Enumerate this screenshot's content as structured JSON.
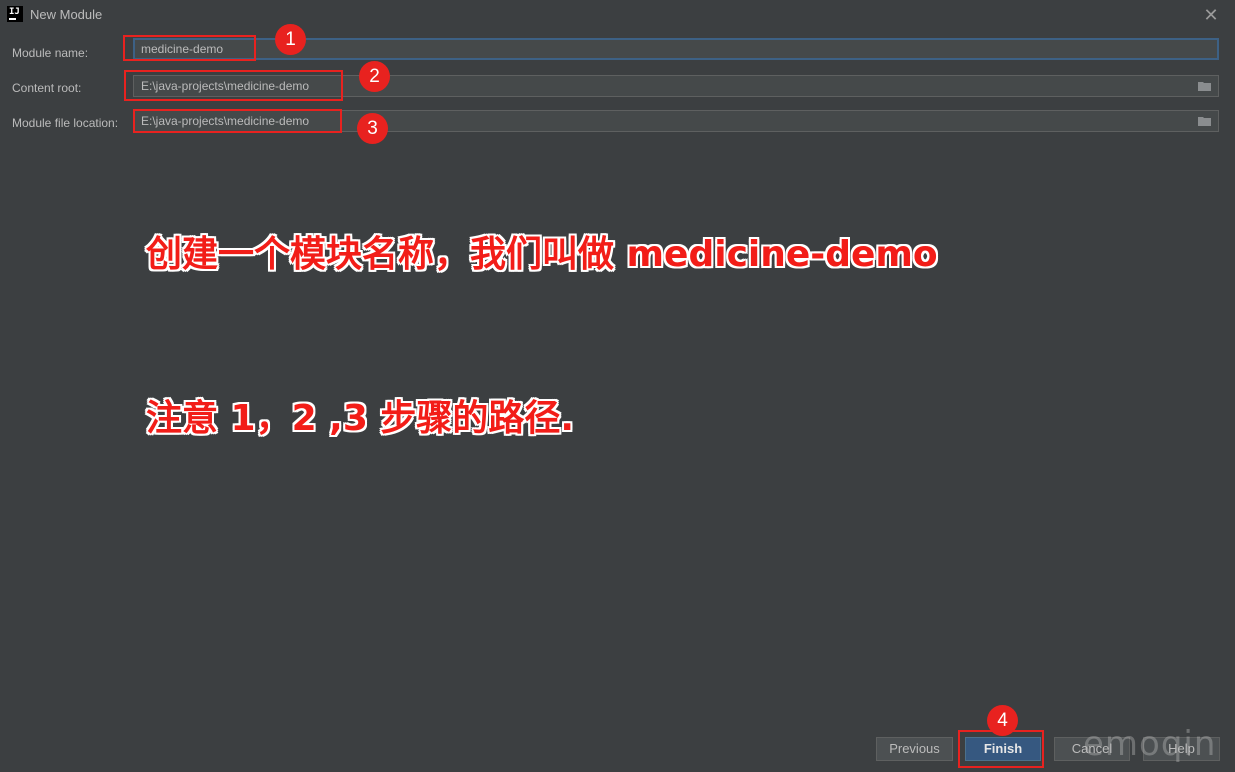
{
  "window": {
    "title": "New Module",
    "app_icon_text": "IJ"
  },
  "form": {
    "module_name_label": "Module name:",
    "module_name_value": "medicine-demo",
    "content_root_label": "Content root:",
    "content_root_value": "E:\\java-projects\\medicine-demo",
    "module_file_label": "Module file location:",
    "module_file_value": "E:\\java-projects\\medicine-demo"
  },
  "annotations": {
    "badges": [
      "1",
      "2",
      "3",
      "4"
    ],
    "line1": "创建一个模块名称，我们叫做 medicine-demo",
    "line2": "注意 1，2 ,3 步骤的路径."
  },
  "buttons": {
    "previous": "Previous",
    "finish": "Finish",
    "cancel": "Cancel",
    "help": "Help"
  },
  "watermark": "emoqin",
  "colors": {
    "background": "#3c3f41",
    "annotation_red": "#f21d18",
    "focus_border": "#3d6185",
    "finish_button": "#365880"
  }
}
